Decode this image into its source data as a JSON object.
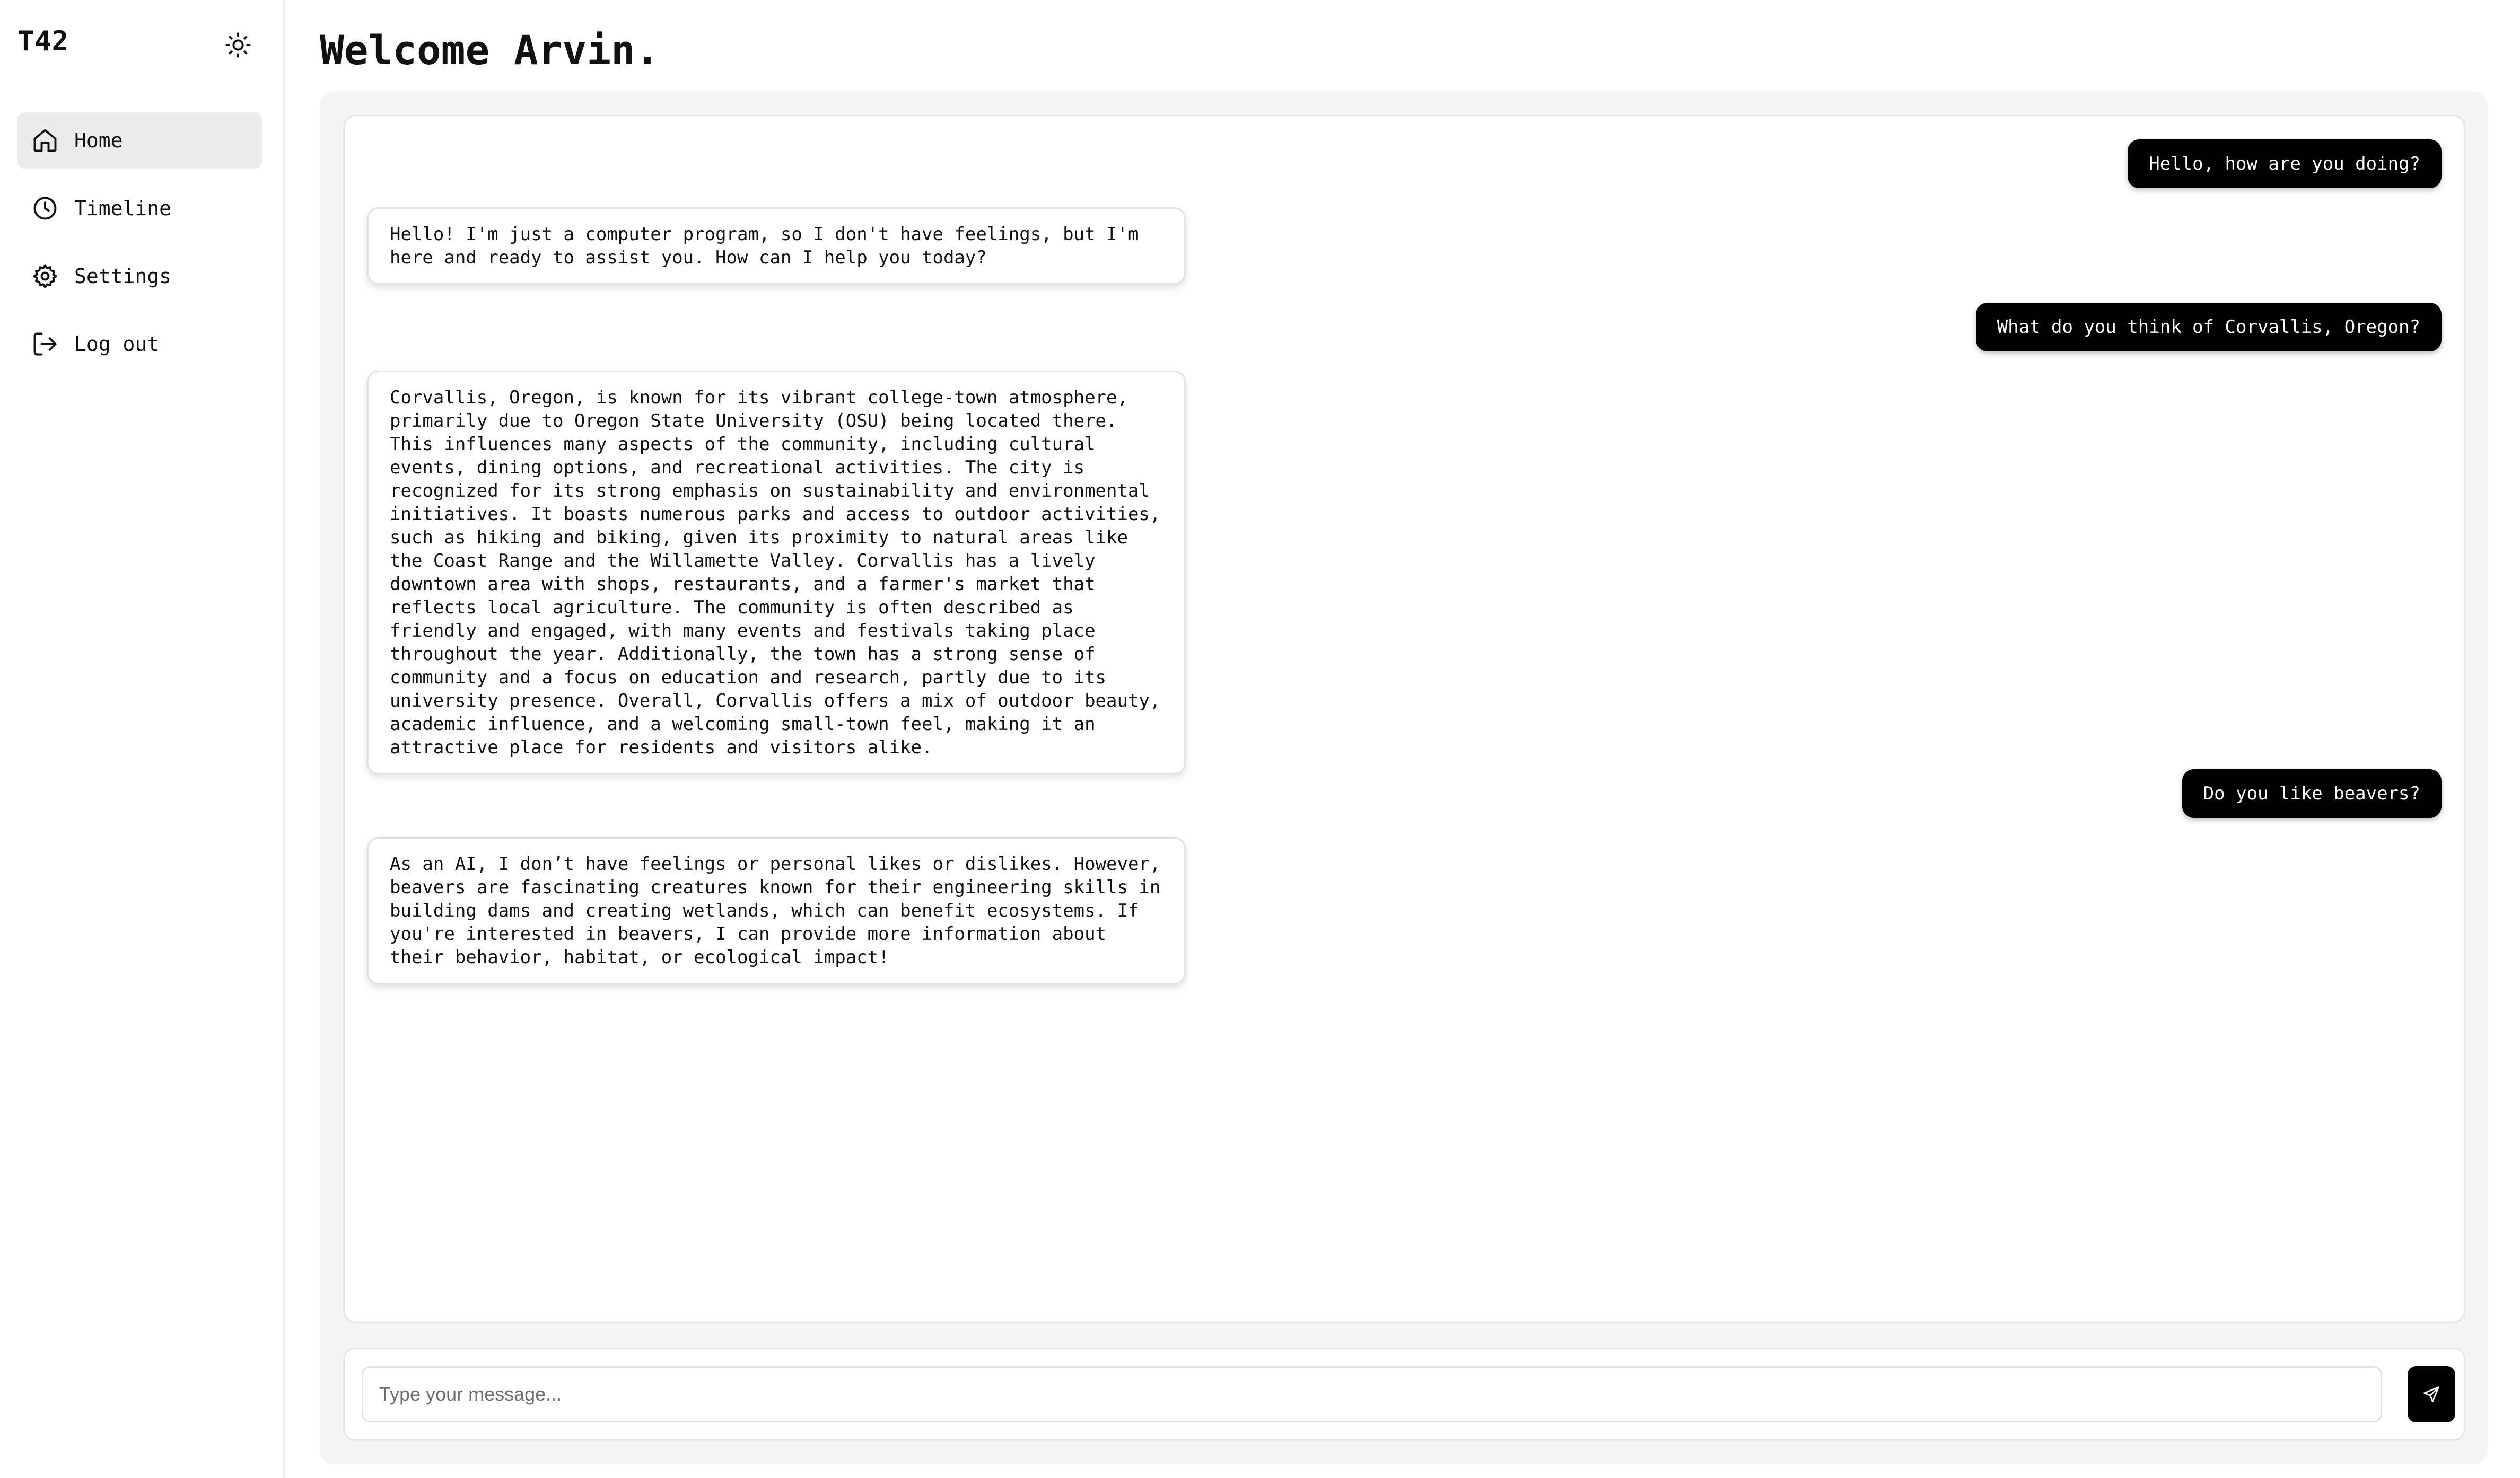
{
  "app": {
    "brand": "T42",
    "theme_toggle_icon": "sun-icon"
  },
  "sidebar": {
    "items": [
      {
        "label": "Home",
        "icon": "home-icon",
        "active": true
      },
      {
        "label": "Timeline",
        "icon": "clock-icon",
        "active": false
      },
      {
        "label": "Settings",
        "icon": "gear-icon",
        "active": false
      },
      {
        "label": "Log out",
        "icon": "logout-icon",
        "active": false
      }
    ]
  },
  "main": {
    "welcome": "Welcome Arvin."
  },
  "chat": {
    "messages": [
      {
        "role": "user",
        "text": "Hello, how are you doing?"
      },
      {
        "role": "assistant",
        "text": "Hello! I'm just a computer program, so I don't have feelings, but I'm here and ready to assist you. How can I help you today?"
      },
      {
        "role": "user",
        "text": "What do you think of Corvallis, Oregon?"
      },
      {
        "role": "assistant",
        "text": "Corvallis, Oregon, is known for its vibrant college-town atmosphere, primarily due to Oregon State University (OSU) being located there. This influences many aspects of the community, including cultural events, dining options, and recreational activities. The city is recognized for its strong emphasis on sustainability and environmental initiatives. It boasts numerous parks and access to outdoor activities, such as hiking and biking, given its proximity to natural areas like the Coast Range and the Willamette Valley. Corvallis has a lively downtown area with shops, restaurants, and a farmer's market that reflects local agriculture. The community is often described as friendly and engaged, with many events and festivals taking place throughout the year. Additionally, the town has a strong sense of community and a focus on education and research, partly due to its university presence. Overall, Corvallis offers a mix of outdoor beauty, academic influence, and a welcoming small-town feel, making it an attractive place for residents and visitors alike."
      },
      {
        "role": "user",
        "text": "Do you like beavers?"
      },
      {
        "role": "assistant",
        "text": "As an AI, I don’t have feelings or personal likes or dislikes. However, beavers are fascinating creatures known for their engineering skills in building dams and creating wetlands, which can benefit ecosystems. If you're interested in beavers, I can provide more information about their behavior, habitat, or ecological impact!"
      }
    ]
  },
  "composer": {
    "placeholder": "Type your message...",
    "value": "",
    "send_icon": "send-icon"
  }
}
